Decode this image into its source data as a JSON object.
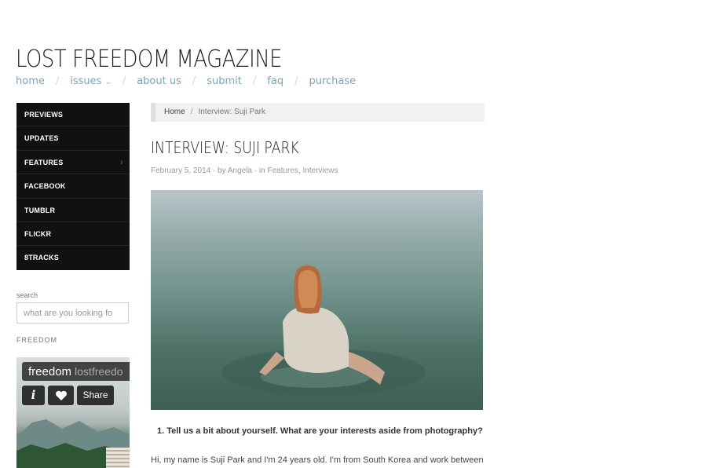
{
  "site": {
    "title": "LOST FREEDOM MAGAZINE"
  },
  "topnav": {
    "items": [
      {
        "label": "home"
      },
      {
        "label": "issues"
      },
      {
        "label": "about us"
      },
      {
        "label": "submit"
      },
      {
        "label": "faq"
      },
      {
        "label": "purchase"
      }
    ],
    "separator": "/"
  },
  "sidebar": {
    "menu": [
      {
        "label": "PREVIEWS"
      },
      {
        "label": "UPDATES"
      },
      {
        "label": "FEATURES"
      },
      {
        "label": "FACEBOOK"
      },
      {
        "label": "TUMBLR"
      },
      {
        "label": "FLICKR"
      },
      {
        "label": "8TRACKS"
      }
    ],
    "search_label": "search",
    "search_placeholder": "what are you looking fo",
    "freedom_heading": "FREEDOM",
    "widget": {
      "name": "freedom",
      "handle": "lostfreedo",
      "info_label": "i",
      "share_label": "Share"
    }
  },
  "breadcrumb": {
    "home": "Home",
    "separator": "/",
    "current": "Interview: Suji Park"
  },
  "post": {
    "title": "INTERVIEW: SUJI PARK",
    "date": "February 5, 2014",
    "by": "· by",
    "author": "Angela",
    "in": "· in",
    "category1": "Features",
    "comma": ",",
    "category2": "Interviews",
    "question": "1. Tell us a bit about yourself. What are your interests aside from photography?",
    "answer": "Hi, my name is Suji Park and I'm 24 years old. I'm from South Korea and work between"
  },
  "colors": {
    "nav_link": "#7fa3b2",
    "menu_bg": "#111111",
    "breadcrumb_bg": "#f1f1f1"
  },
  "icons": {
    "issues_caret": "chevron-down-icon",
    "features_chevron": "chevron-right-icon",
    "like": "heart-icon"
  }
}
